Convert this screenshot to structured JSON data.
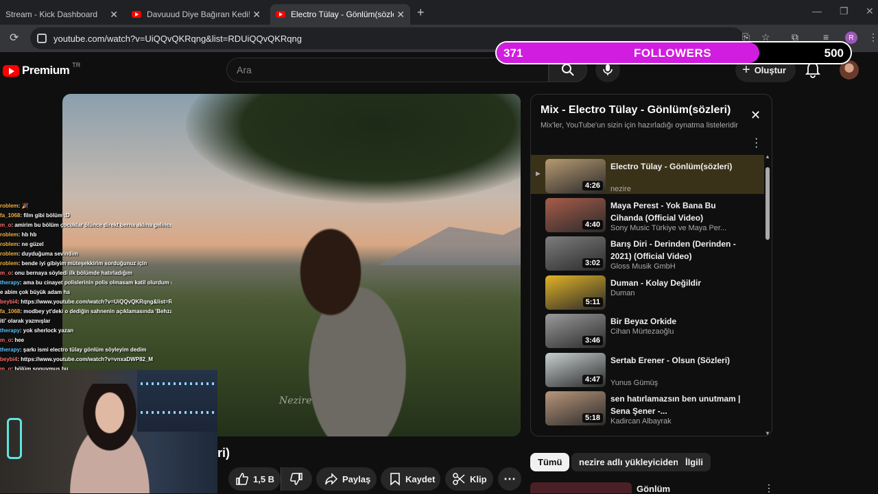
{
  "browser": {
    "tabs": [
      {
        "title": "Stream - Kick Dashboard"
      },
      {
        "title": "Davuuud Diye Bağıran Kedi!! İz"
      },
      {
        "title": "Electro Tülay - Gönlüm(sözleri)"
      }
    ],
    "url": "youtube.com/watch?v=UiQQvQKRqng&list=RDUiQQvQKRqng"
  },
  "youtube": {
    "brand": "Premium",
    "region": "TR",
    "search_placeholder": "Ara",
    "create_label": "Oluştur"
  },
  "followers_overlay": {
    "current": "371",
    "label": "FOLLOWERS",
    "goal": "500",
    "progress": 0.742,
    "fill_color": "#d11ddf"
  },
  "player": {
    "watermark": "Nezire",
    "title_fragment": "ri)"
  },
  "actions": {
    "likes": "1,5 B",
    "share": "Paylaş",
    "save": "Kaydet",
    "clip": "Klip"
  },
  "chat": [
    {
      "user": "roblem",
      "text": ": 🎉",
      "color": "u"
    },
    {
      "user": "fa_1068",
      "text": ": film gibi bölüm :D",
      "color": "u"
    },
    {
      "user": "m_o",
      "text": ": amirim bu bölüm çocuklar ölünce direkt berna aklına gelince",
      "color": "u r"
    },
    {
      "user": "roblem",
      "text": ": hb hb",
      "color": "u"
    },
    {
      "user": "roblem",
      "text": ": ne güzel",
      "color": "u"
    },
    {
      "user": "roblem",
      "text": ": duyduğuma sevindim",
      "color": "u"
    },
    {
      "user": "roblem",
      "text": ": bende iyi gibiyim müteşekkirim sorduğunuz için",
      "color": "u"
    },
    {
      "user": "m_o",
      "text": ": onu bernaya söyledi ilk bölümde hatırladığım",
      "color": "u r"
    },
    {
      "user": "therapy",
      "text": ": ama bu cinayet polislerinin polis olmasam katil olurdum muhab",
      "color": "u b"
    },
    {
      "user": "",
      "text": "e abim çok büyük adam ha",
      "color": "u"
    },
    {
      "user": "beybi4",
      "text": ": https://www.youtube.com/watch?v=UiQQvQKRqng&list=RDUiQQ",
      "color": "u r"
    },
    {
      "user": "fa_1068",
      "text": ": modbey yt'deki o dediğin sahnenin açıklamasında 'Behzat Ç.nin",
      "color": "u"
    },
    {
      "user": "",
      "text": "iti' olarak yazmışlar",
      "color": "u"
    },
    {
      "user": "therapy",
      "text": ": yok sherlock yazan",
      "color": "u b"
    },
    {
      "user": "m_o",
      "text": ": hee",
      "color": "u r"
    },
    {
      "user": "therapy",
      "text": ": şarkı ismi electro tülay gönlüm söyleyim dedim",
      "color": "u b"
    },
    {
      "user": "beybi4",
      "text": ": https://www.youtube.com/watch?v=vnxaDWP82_M",
      "color": "u r"
    },
    {
      "user": "m_o",
      "text": ": bölüm sonuymuş bu",
      "color": "u r"
    }
  ],
  "playlist": {
    "title": "Mix - Electro Tülay - Gönlüm(sözleri)",
    "subtitle": "Mix'ler, YouTube'un sizin için hazırladığı oynatma listeleridir",
    "items": [
      {
        "title": "Electro Tülay - Gönlüm(sözleri)",
        "channel": "nezire",
        "duration": "4:26",
        "active": true,
        "thumb": "#b79a72"
      },
      {
        "title": "Maya Perest - Yok Bana Bu Cihanda (Official Video)",
        "channel": "Sony Music Türkiye ve Maya Per...",
        "duration": "4:40",
        "active": false,
        "thumb": "#a85c4a"
      },
      {
        "title": "Barış Diri - Derinden (Derinden - 2021) (Official Video)",
        "channel": "Gloss Musik GmbH",
        "duration": "3:02",
        "active": false,
        "thumb": "#7d7d7d"
      },
      {
        "title": "Duman - Kolay Değildir",
        "channel": "Duman",
        "duration": "5:11",
        "active": false,
        "thumb": "#e2b326"
      },
      {
        "title": "Bir Beyaz Orkide",
        "channel": "Cihan Mürtezaoğlu",
        "duration": "3:46",
        "active": false,
        "thumb": "#9a9a9a"
      },
      {
        "title": "Sertab Erener - Olsun (Sözleri)",
        "channel": "Yunus Gümüş",
        "duration": "4:47",
        "active": false,
        "thumb": "#c8cfd0"
      },
      {
        "title": "sen hatırlamazsın ben unutmam | Sena Şener -...",
        "channel": "Kadircan Albayrak",
        "duration": "5:18",
        "active": false,
        "thumb": "#b9967a"
      }
    ]
  },
  "chips": [
    "Tümü",
    "nezire adlı yükleyiciden",
    "İlgili"
  ],
  "next_video": {
    "title": "Gönlüm"
  }
}
